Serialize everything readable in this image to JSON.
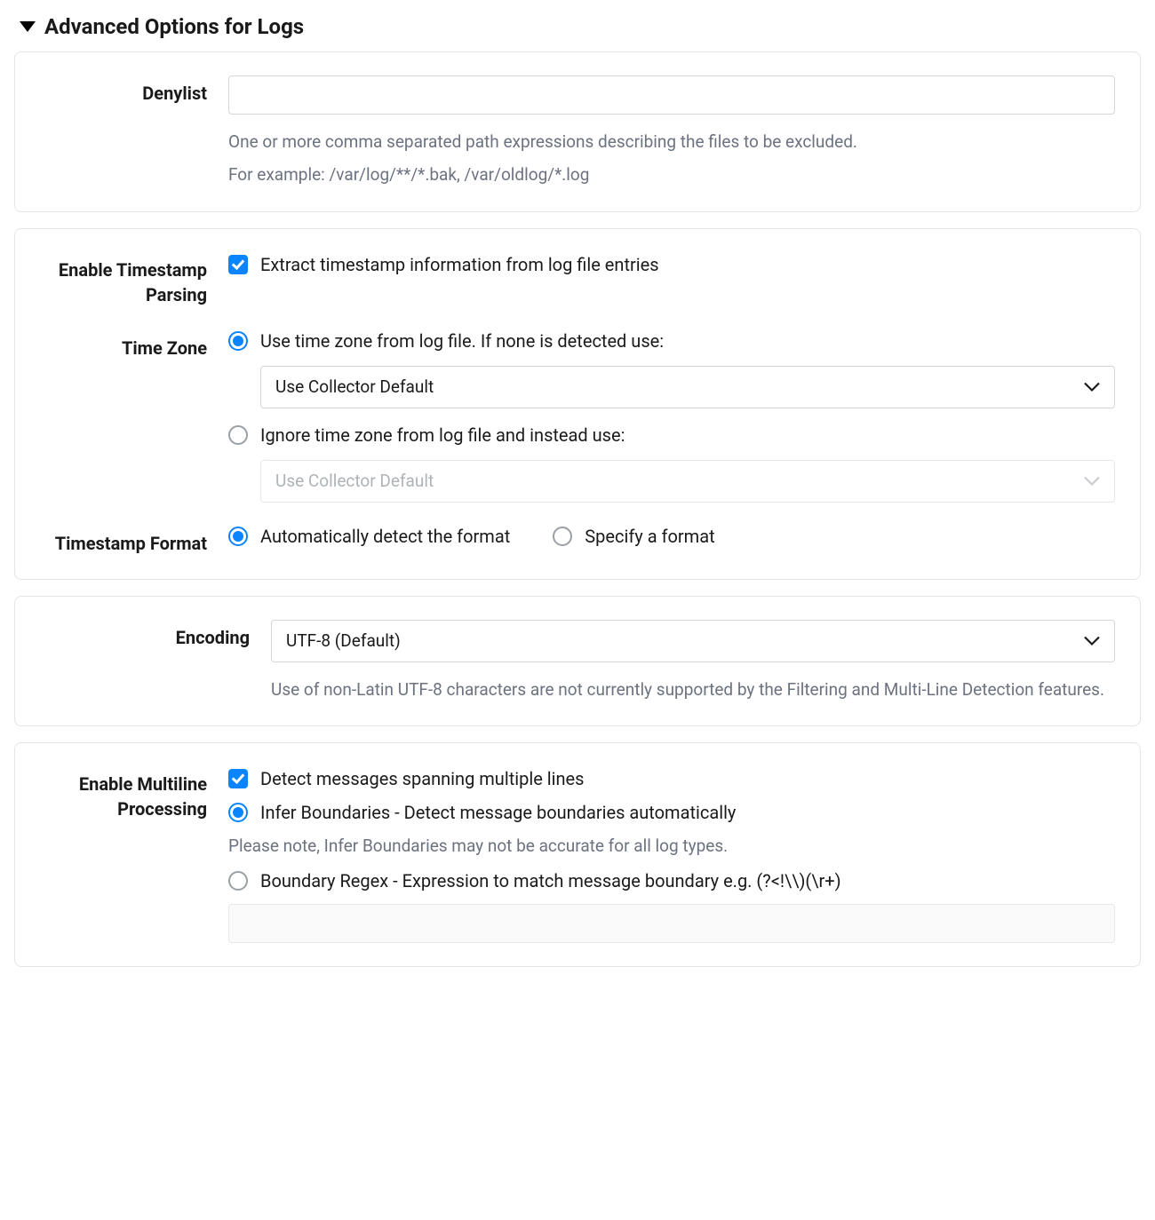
{
  "header": {
    "title": "Advanced Options for Logs"
  },
  "denylist": {
    "label": "Denylist",
    "value": "",
    "help1": "One or more comma separated path expressions describing the files to be excluded.",
    "help2": "For example: /var/log/**/*.bak, /var/oldlog/*.log"
  },
  "timestamp": {
    "enable_label": "Enable Timestamp Parsing",
    "enable_option": "Extract timestamp information from log file entries",
    "timezone_label": "Time Zone",
    "tz_use_file": "Use time zone from log file. If none is detected use:",
    "tz_select_use": "Use Collector Default",
    "tz_ignore": "Ignore time zone from log file and instead use:",
    "tz_select_ignore": "Use Collector Default",
    "format_label": "Timestamp Format",
    "format_auto": "Automatically detect the format",
    "format_specify": "Specify a format"
  },
  "encoding": {
    "label": "Encoding",
    "value": "UTF-8 (Default)",
    "help": "Use of non-Latin UTF-8 characters are not currently supported by the Filtering and Multi-Line Detection features."
  },
  "multiline": {
    "label": "Enable Multiline Processing",
    "detect": "Detect messages spanning multiple lines",
    "infer": "Infer Boundaries - Detect message boundaries automatically",
    "infer_note": "Please note, Infer Boundaries may not be accurate for all log types.",
    "regex": "Boundary Regex - Expression to match message boundary e.g. (?<!\\\\)(\\r+)",
    "regex_value": ""
  }
}
